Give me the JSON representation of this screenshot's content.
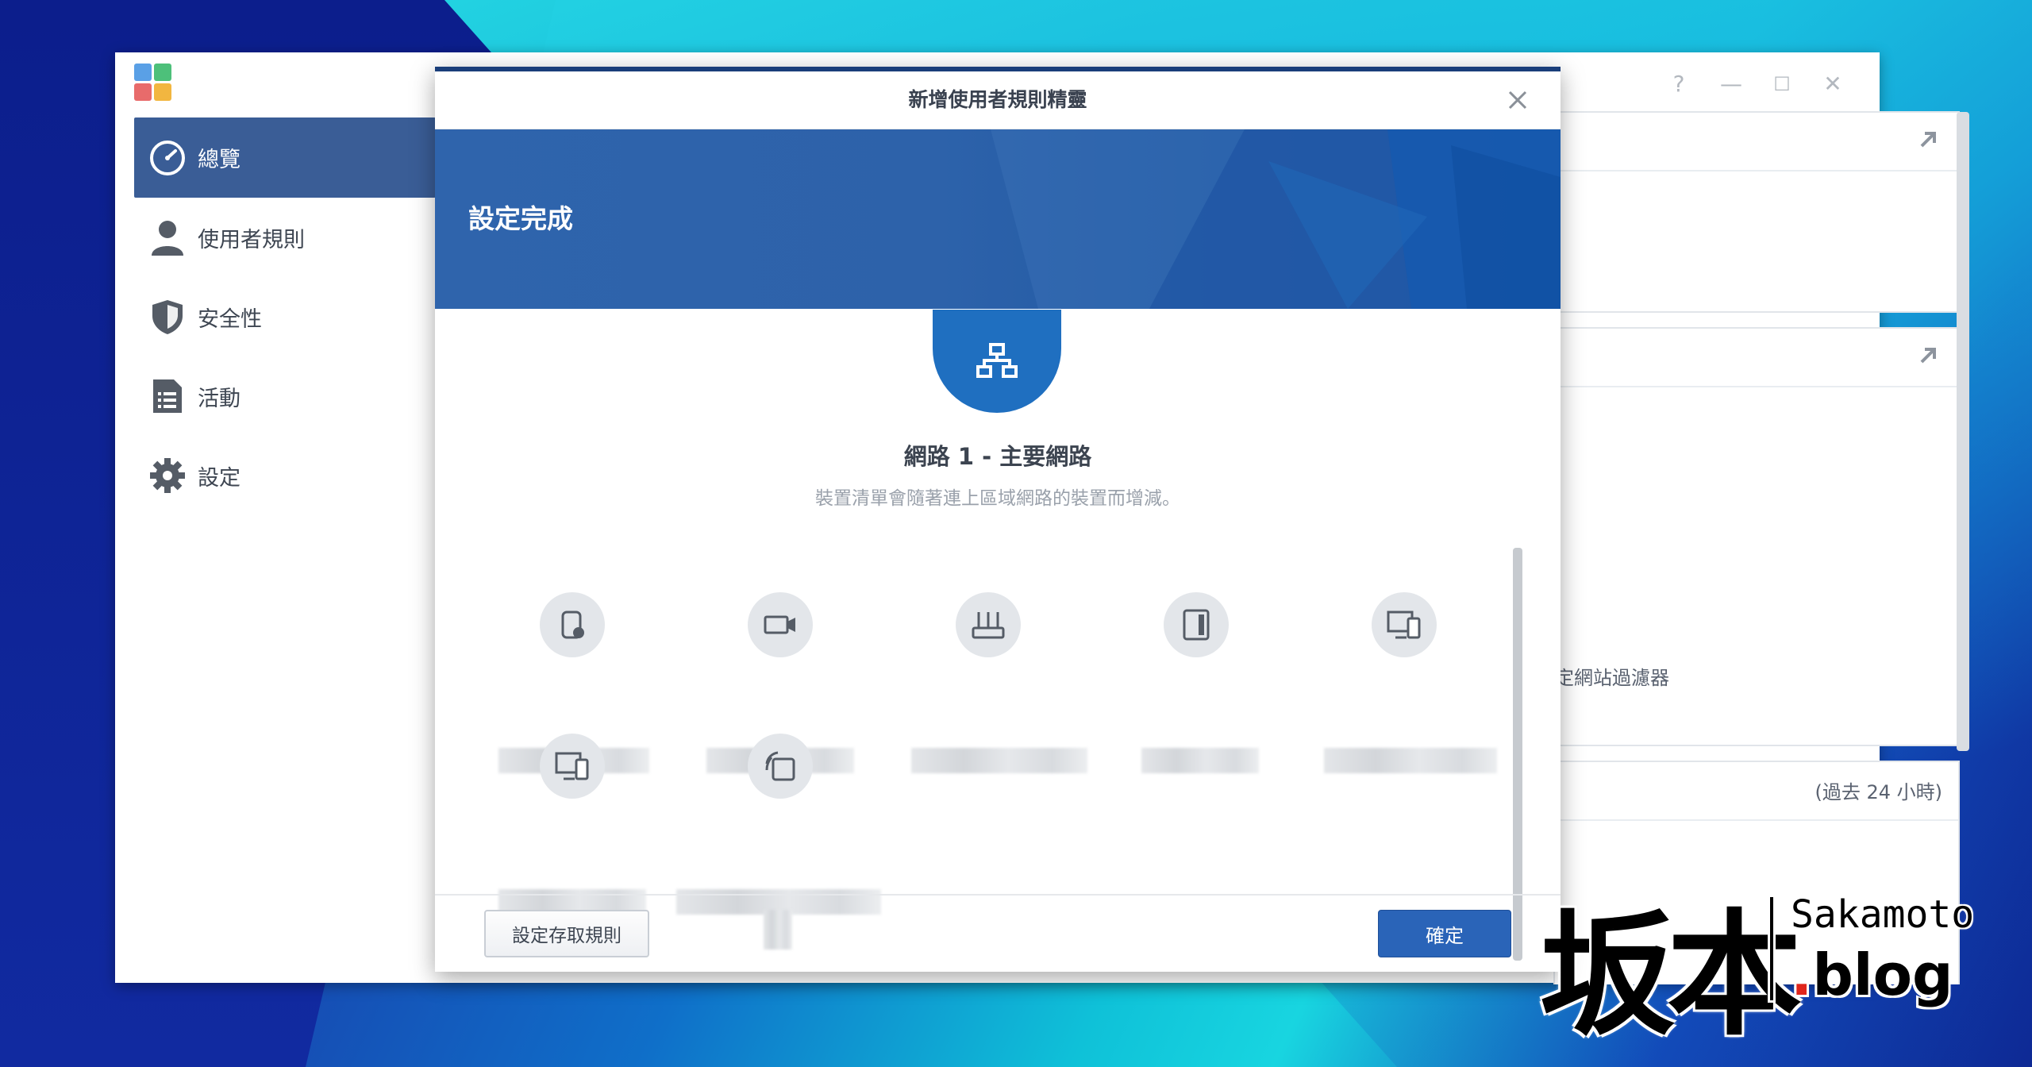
{
  "app": {
    "window_controls": [
      "?",
      "—",
      "☐",
      "✕"
    ],
    "sidebar": {
      "items": [
        {
          "label": "總覽",
          "icon": "speedometer-icon",
          "active": true
        },
        {
          "label": "使用者規則",
          "icon": "user-icon",
          "active": false
        },
        {
          "label": "安全性",
          "icon": "shield-icon",
          "active": false
        },
        {
          "label": "活動",
          "icon": "document-list-icon",
          "active": false
        },
        {
          "label": "設定",
          "icon": "gear-icon",
          "active": false
        }
      ]
    },
    "cards": {
      "filter_text": "定網站過濾器",
      "time_range": "(過去 24 小時)"
    }
  },
  "dialog": {
    "title": "新增使用者規則精靈",
    "banner_title": "設定完成",
    "network_title": "網路 1 - 主要網路",
    "network_subtitle": "裝置清單會隨著連上區域網路的裝置而增減。",
    "devices": [
      {
        "icon": "nas-device-icon"
      },
      {
        "icon": "camera-device-icon"
      },
      {
        "icon": "router-device-icon"
      },
      {
        "icon": "tablet-device-icon"
      },
      {
        "icon": "computer-phone-device-icon"
      },
      {
        "icon": "computer-phone-device-icon"
      },
      {
        "icon": "wireless-device-icon"
      }
    ],
    "buttons": {
      "access_rule": "設定存取規則",
      "confirm": "確定"
    }
  },
  "watermark": {
    "kanji": "坂本",
    "sakamoto": "Sakamoto",
    "blog": "blog"
  },
  "colors": {
    "accent_blue": "#2a64b8",
    "sidebar_active": "#3a5d96",
    "banner_blue": "#2d62aa"
  }
}
